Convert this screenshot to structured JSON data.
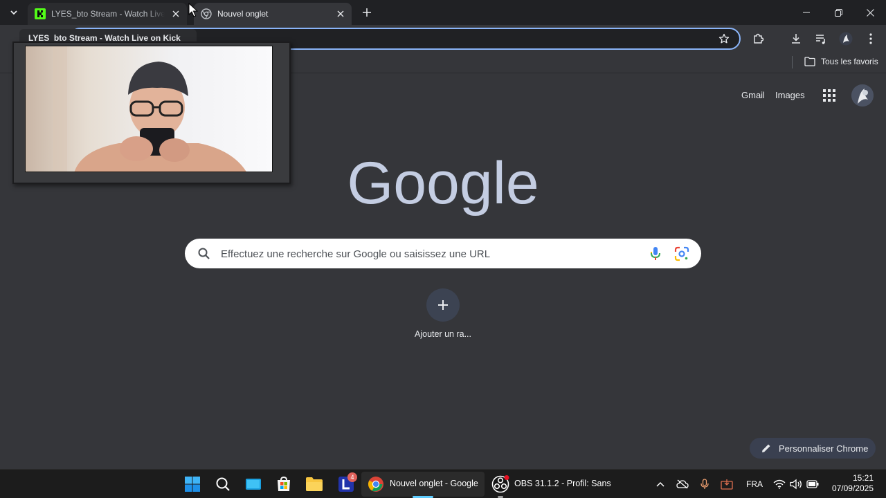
{
  "browser": {
    "tabs": [
      {
        "title": "LYES_bto Stream - Watch Live on Kick",
        "favicon": "kick-logo-icon",
        "active": false
      },
      {
        "title": "Nouvel onglet",
        "favicon": "chrome-icon",
        "active": true
      }
    ],
    "tooltip": "LYES_bto Stream - Watch Live on Kick",
    "bookmarks": {
      "all_label": "Tous les favoris"
    },
    "accent": "#8ab4f8"
  },
  "ntp": {
    "links": {
      "gmail": "Gmail",
      "images": "Images"
    },
    "logo_text": "Google",
    "search_placeholder": "Effectuez une recherche sur Google ou saisissez une URL",
    "shortcut_add_label": "Ajouter un ra...",
    "customize_label": "Personnaliser Chrome"
  },
  "taskbar": {
    "apps": [
      {
        "name": "windows-start-icon"
      },
      {
        "name": "search-icon"
      },
      {
        "name": "task-view-icon"
      },
      {
        "name": "microsoft-store-icon"
      },
      {
        "name": "file-explorer-icon"
      },
      {
        "name": "app-l-icon",
        "badge": "4"
      },
      {
        "name": "chrome-icon",
        "label": "Nouvel onglet - Google",
        "active": true
      },
      {
        "name": "obs-icon",
        "label": "OBS 31.1.2 - Profil: Sans"
      }
    ],
    "language": "FRA",
    "time": "15:21",
    "date": "07/09/2025"
  }
}
